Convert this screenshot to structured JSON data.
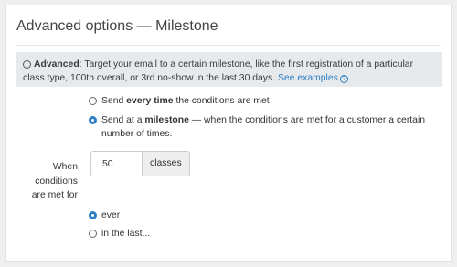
{
  "panel": {
    "title": "Advanced options — Milestone"
  },
  "alert": {
    "icon": "info-icon",
    "lead": "Advanced",
    "body": ": Target your email to a certain milestone, like the first registration of a particular class type, 100th overall, or 3rd no-show in the last 30 days.",
    "link_label": "See examples",
    "link_icon": "question-circle-icon"
  },
  "trigger_mode": {
    "options": [
      {
        "prefix": "Send ",
        "strong": "every time",
        "suffix": " the conditions are met",
        "checked": false
      },
      {
        "prefix": "Send at a ",
        "strong": "milestone",
        "suffix": " — when the conditions are met for a customer a certain number of times.",
        "checked": true
      }
    ]
  },
  "milestone": {
    "label": "When conditions are met for",
    "value": "50",
    "unit": "classes"
  },
  "period": {
    "options": [
      {
        "label": "ever",
        "checked": true
      },
      {
        "label": "in the last...",
        "checked": false
      }
    ]
  },
  "colors": {
    "accent": "#2d7fc5",
    "alert_bg": "#e7eaed",
    "page_bg": "#efefef"
  }
}
